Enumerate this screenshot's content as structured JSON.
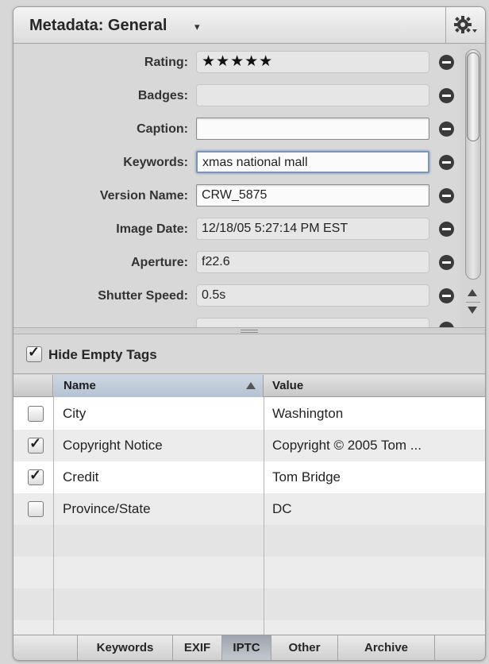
{
  "header": {
    "title": "Metadata: General",
    "chevron": "▾",
    "gear_icon": "gear-icon"
  },
  "fields": [
    {
      "label": "Rating:",
      "value": "★★★★★"
    },
    {
      "label": "Badges:",
      "value": ""
    },
    {
      "label": "Caption:",
      "value": ""
    },
    {
      "label": "Keywords:",
      "value": "xmas national mall"
    },
    {
      "label": "Version Name:",
      "value": "CRW_5875"
    },
    {
      "label": "Image Date:",
      "value": "12/18/05 5:27:14 PM EST"
    },
    {
      "label": "Aperture:",
      "value": "f22.6"
    },
    {
      "label": "Shutter Speed:",
      "value": "0.5s"
    }
  ],
  "hide_empty_tags": {
    "label": "Hide Empty Tags",
    "checked": true
  },
  "table": {
    "headers": {
      "name": "Name",
      "value": "Value"
    },
    "rows": [
      {
        "checked": false,
        "name": "City",
        "value": "Washington"
      },
      {
        "checked": true,
        "name": "Copyright Notice",
        "value": "Copyright © 2005 Tom ..."
      },
      {
        "checked": true,
        "name": "Credit",
        "value": "Tom Bridge"
      },
      {
        "checked": false,
        "name": "Province/State",
        "value": "DC"
      }
    ]
  },
  "tabs": [
    {
      "label": "Keywords",
      "active": false
    },
    {
      "label": "EXIF",
      "active": false
    },
    {
      "label": "IPTC",
      "active": true
    },
    {
      "label": "Other",
      "active": false
    },
    {
      "label": "Archive",
      "active": false
    }
  ],
  "check_mark": "✓"
}
